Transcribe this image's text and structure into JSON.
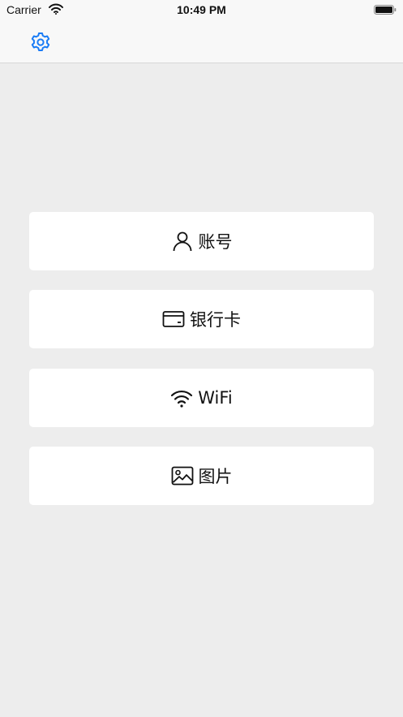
{
  "status_bar": {
    "carrier": "Carrier",
    "time": "10:49 PM"
  },
  "nav_bar": {
    "settings_icon": "gear-icon",
    "accent_color": "#1a7cf5"
  },
  "menu": [
    {
      "label": "账号",
      "icon": "user-icon"
    },
    {
      "label": "银行卡",
      "icon": "credit-card-icon"
    },
    {
      "label": "WiFi",
      "icon": "wifi-icon"
    },
    {
      "label": "图片",
      "icon": "image-icon"
    }
  ],
  "colors": {
    "background": "#ededed",
    "card": "#ffffff",
    "text": "#111111"
  }
}
